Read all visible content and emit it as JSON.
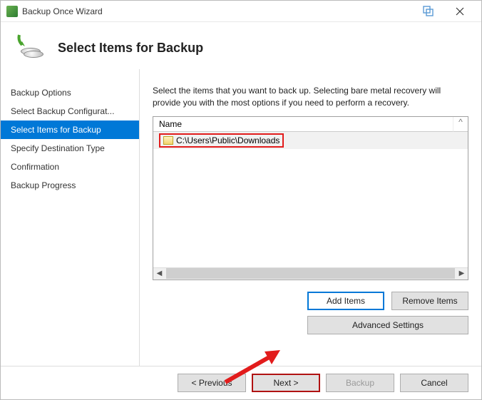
{
  "window": {
    "title": "Backup Once Wizard"
  },
  "header": {
    "title": "Select Items for Backup"
  },
  "sidebar": {
    "items": [
      {
        "label": "Backup Options"
      },
      {
        "label": "Select Backup Configurat..."
      },
      {
        "label": "Select Items for Backup"
      },
      {
        "label": "Specify Destination Type"
      },
      {
        "label": "Confirmation"
      },
      {
        "label": "Backup Progress"
      }
    ],
    "active_index": 2
  },
  "main": {
    "instruction": "Select the items that you want to back up. Selecting bare metal recovery will provide you with the most options if you need to perform a recovery.",
    "list": {
      "column_header": "Name",
      "rows": [
        {
          "path": "C:\\Users\\Public\\Downloads"
        }
      ]
    },
    "buttons": {
      "add": "Add Items",
      "remove": "Remove Items",
      "advanced": "Advanced Settings"
    }
  },
  "footer": {
    "previous": "< Previous",
    "next": "Next >",
    "backup": "Backup",
    "cancel": "Cancel"
  }
}
